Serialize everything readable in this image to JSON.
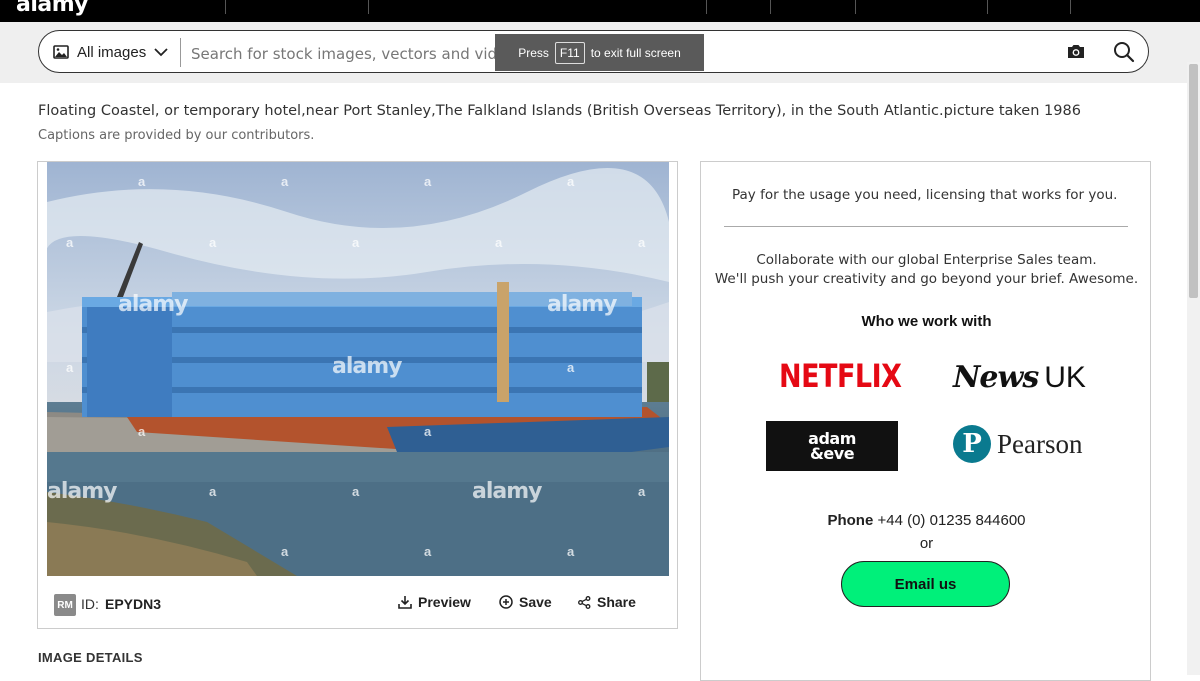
{
  "topbar": {
    "logo": "alamy"
  },
  "search": {
    "category_label": "All images",
    "placeholder": "Search for stock images, vectors and videos"
  },
  "fullscreen_toast": {
    "prefix": "Press",
    "key": "F11",
    "suffix": "to exit full screen"
  },
  "image": {
    "caption": "Floating Coastel, or temporary hotel,near Port Stanley,The Falkland Islands (British Overseas Territory), in the South Atlantic.picture taken 1986",
    "caption_note": "Captions are provided by our contributors.",
    "watermark_big": "alamy",
    "watermark_small": "a",
    "license_badge": "RM",
    "id_label": "ID:",
    "id_value": "EPYDN3",
    "actions": {
      "preview": "Preview",
      "save": "Save",
      "share": "Share"
    }
  },
  "details_heading": "IMAGE DETAILS",
  "sidebar": {
    "pay_text": "Pay for the usage you need, licensing that works for you.",
    "collab_line1": "Collaborate with our global Enterprise Sales team.",
    "collab_line2": "We'll push your creativity and go beyond your brief. Awesome.",
    "who_heading": "Who we work with",
    "logos": {
      "netflix": "NETFLIX",
      "news_uk_news": "News",
      "news_uk_uk": "UK",
      "adam_eve_1": "adam",
      "adam_eve_2": "&eve",
      "pearson": "Pearson"
    },
    "phone_label": "Phone",
    "phone_number": "+44 (0) 01235 844600",
    "or_text": "or",
    "email_button": "Email us"
  }
}
